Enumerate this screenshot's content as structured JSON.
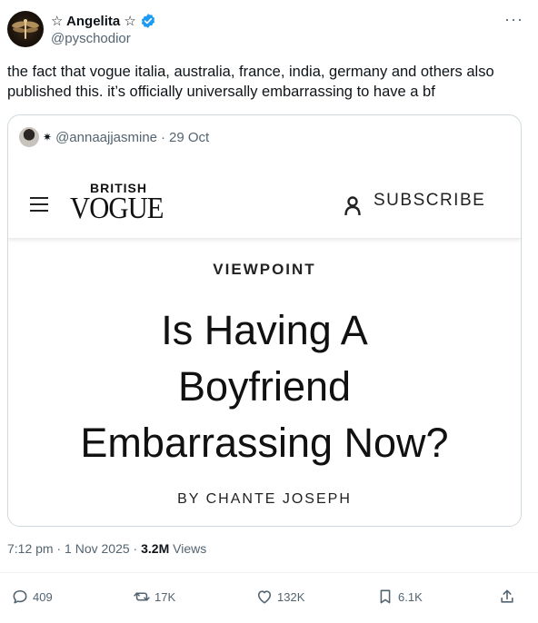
{
  "author": {
    "display_name": "☆ Angelita ☆",
    "handle": "@pyschodior"
  },
  "tweet": {
    "text": "the fact that vogue italia, australia, france, india, germany and others also published this. it’s officially universally embarrassing to have a bf"
  },
  "quoted": {
    "prefix_symbol": "✷",
    "handle": "@annaajjasmine",
    "separator": "·",
    "date": "29 Oct",
    "image": {
      "brand_top": "BRITISH",
      "brand_logo": "VOGUE",
      "subscribe_label": "SUBSCRIBE",
      "section": "VIEWPOINT",
      "headline_lines": [
        "Is Having A",
        "Boyfriend",
        "Embarrassing Now?"
      ],
      "byline": "BY CHANTE JOSEPH"
    }
  },
  "meta": {
    "time": "7:12 pm",
    "separator": "·",
    "date": "1 Nov 2025",
    "views_count": "3.2M",
    "views_label": "Views"
  },
  "actions": {
    "replies": "409",
    "reposts": "17K",
    "likes": "132K",
    "bookmarks": "6.1K"
  },
  "colors": {
    "verified": "#1d9bf0",
    "text": "#0f1419",
    "secondary": "#536471",
    "border": "#cfd9de"
  }
}
